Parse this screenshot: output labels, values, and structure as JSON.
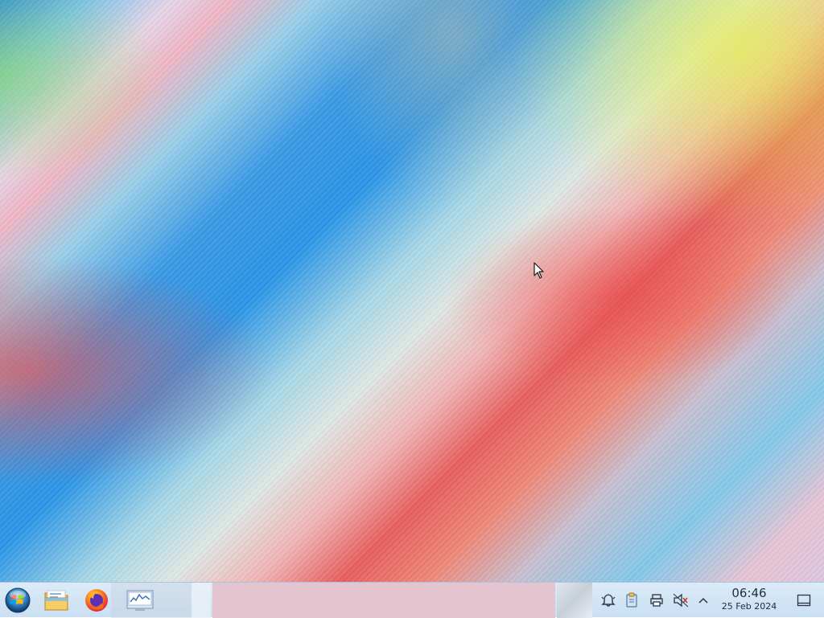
{
  "desktop": {
    "wallpaper": "rainbow-diagonal-wallpaper"
  },
  "taskbar": {
    "start_icon": "windows-orb-icon",
    "launchers": [
      {
        "icon": "file-manager-icon"
      },
      {
        "icon": "firefox-icon"
      },
      {
        "icon": "system-monitor-icon"
      }
    ],
    "tray": {
      "icons": [
        "notification-bell-icon",
        "clipboard-icon",
        "printer-icon",
        "volume-muted-icon",
        "chevron-up-icon"
      ],
      "clock": {
        "time": "06:46",
        "date": "25 Feb 2024"
      },
      "show_desktop_icon": "show-desktop-icon"
    }
  },
  "colors": {
    "taskbar_bg": "#d2e4f5",
    "task_area_bg": "#e3c4cf",
    "text": "#1f2d3d"
  }
}
